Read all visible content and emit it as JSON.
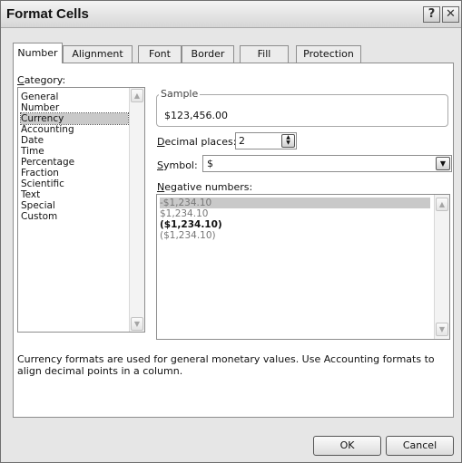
{
  "window": {
    "title": "Format Cells",
    "help_glyph": "?",
    "close_glyph": "✕"
  },
  "tabs": [
    "Number",
    "Alignment",
    "Font",
    "Border",
    "Fill",
    "Protection"
  ],
  "active_tab": "Number",
  "category": {
    "label_underline": "C",
    "label_rest": "ategory:",
    "items": [
      "General",
      "Number",
      "Currency",
      "Accounting",
      "Date",
      "Time",
      "Percentage",
      "Fraction",
      "Scientific",
      "Text",
      "Special",
      "Custom"
    ],
    "selected": "Currency"
  },
  "sample": {
    "legend": "Sample",
    "value": "$123,456.00"
  },
  "decimal_places": {
    "label_underline": "D",
    "label_rest": "ecimal places:",
    "value": "2"
  },
  "symbol": {
    "label_underline": "S",
    "label_rest": "ymbol:",
    "value": "$"
  },
  "negative_numbers": {
    "label_underline": "N",
    "label_rest": "egative numbers:",
    "items": [
      "-$1,234.10",
      "$1,234.10",
      "($1,234.10)",
      "($1,234.10)"
    ],
    "selected_index": 0
  },
  "description": "Currency formats are used for general monetary values.  Use Accounting formats to align decimal points in a column.",
  "buttons": {
    "ok": "OK",
    "cancel": "Cancel"
  },
  "icons": {
    "up_arrow": "▲",
    "down_arrow": "▼",
    "dropdown": "▼"
  }
}
